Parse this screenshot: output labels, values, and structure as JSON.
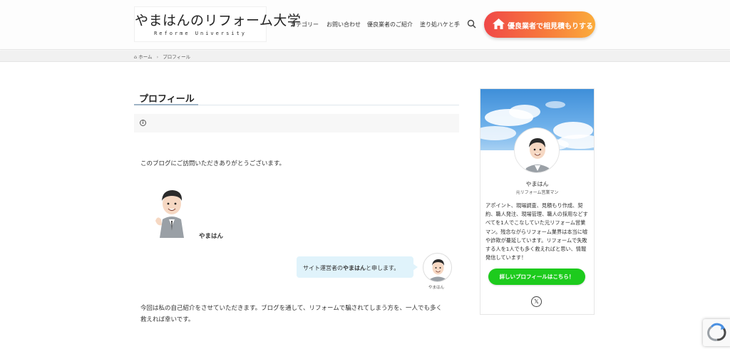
{
  "header": {
    "logo_title": "やまはんのリフォーム大学",
    "logo_sub": "Reforme University",
    "nav": [
      "カテゴリー",
      "お問い合わせ",
      "優良業者のご紹介",
      "塗り処ハケと手"
    ],
    "cta_label": "優良業者で相見積もりする",
    "colors": {
      "cta_start": "#f04848",
      "cta_end": "#fbac3b"
    }
  },
  "breadcrumb": {
    "home": "ホーム",
    "current": "プロフィール"
  },
  "main": {
    "page_title": "プロフィール",
    "info_icon": "ⓘ",
    "intro": "このブログにご訪問いただきありがとうございます。",
    "speaker_name": "やまはん",
    "bubble_pre": "サイト運営者の",
    "bubble_bold": "やまはん",
    "bubble_post": "と申します。",
    "bubble_avatar_label": "やまはん",
    "para_line1": "今回は私の自己紹介をさせていただきます。ブログを通して、リフォームで騙されてしまう方を、一人でも多く",
    "para_line2": "救えれば幸いです。"
  },
  "sidebar": {
    "name": "やまはん",
    "role": "元リフォーム営業マン",
    "bio": "アポイント、現場調査、見積もり作成、契約、職人発注、現場管理、職人の採用などすべてを1人でこなしていた元リフォーム営業マン。残念ながらリフォーム業界は本当に嘘や詐欺が蔓延しています。リフォームで失敗する人を1人でも多く救えればと思い、情報発信しています！",
    "button_label": "詳しいプロフィールはこちら！",
    "social_icon": "𝕏",
    "colors": {
      "button": "#1dcb1d"
    }
  }
}
